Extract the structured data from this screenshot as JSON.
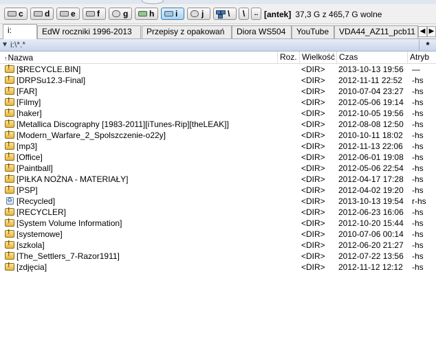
{
  "drive_bar": {
    "drives": [
      {
        "letter": "c",
        "icon": "hard-drive-icon"
      },
      {
        "letter": "d",
        "icon": "hard-drive-icon"
      },
      {
        "letter": "e",
        "icon": "hard-drive-icon"
      },
      {
        "letter": "f",
        "icon": "hard-drive-icon"
      },
      {
        "letter": "g",
        "icon": "usb-drive-icon"
      },
      {
        "letter": "h",
        "icon": "optical-drive-icon"
      },
      {
        "letter": "i",
        "icon": "hard-drive-icon",
        "active": true
      },
      {
        "letter": "j",
        "icon": "usb-drive-icon"
      }
    ],
    "net_icon": "network-icon",
    "root_label": "\\",
    "up_label": "..",
    "volume_label": "[antek]",
    "free_space": "37,3 G z 465,7 G wolne"
  },
  "tabs": [
    {
      "label": "i:",
      "active": true
    },
    {
      "label": "EdW roczniki 1996-2013"
    },
    {
      "label": "Przepisy z opakowań"
    },
    {
      "label": "Diora WS504"
    },
    {
      "label": "YouTube"
    },
    {
      "label": "VDA44_AZ11_pcb11"
    }
  ],
  "tab_nav": {
    "prev": "◀",
    "next": "▶"
  },
  "path_bar": {
    "filter_icon": "▾",
    "path": "i:\\*.*",
    "history_label": "*"
  },
  "columns": {
    "sort_arrow": "↑",
    "name": "Nazwa",
    "ext": "Roz.",
    "size": "Wielkość",
    "date": "Czas",
    "attr": "Atryb"
  },
  "files": [
    {
      "name": "[$RECYCLE.BIN]",
      "size": "<DIR>",
      "date": "2013-10-13 19:56",
      "attr": "—",
      "icon": "folder-icon"
    },
    {
      "name": "[DRPSu12.3-Final]",
      "size": "<DIR>",
      "date": "2012-11-11 22:52",
      "attr": "-hs",
      "icon": "folder-icon"
    },
    {
      "name": "[FAR]",
      "size": "<DIR>",
      "date": "2010-07-04 23:27",
      "attr": "-hs",
      "icon": "folder-icon"
    },
    {
      "name": "[Filmy]",
      "size": "<DIR>",
      "date": "2012-05-06 19:14",
      "attr": "-hs",
      "icon": "folder-icon"
    },
    {
      "name": "[haker]",
      "size": "<DIR>",
      "date": "2012-10-05 19:56",
      "attr": "-hs",
      "icon": "folder-icon"
    },
    {
      "name": "[Metallica Discography [1983-2011][iTunes-Rip][theLEAK]]",
      "size": "<DIR>",
      "date": "2012-08-08 12:50",
      "attr": "-hs",
      "icon": "folder-icon"
    },
    {
      "name": "[Modern_Warfare_2_Spolszczenie-o22y]",
      "size": "<DIR>",
      "date": "2010-10-11 18:02",
      "attr": "-hs",
      "icon": "folder-icon"
    },
    {
      "name": "[mp3]",
      "size": "<DIR>",
      "date": "2012-11-13 22:06",
      "attr": "-hs",
      "icon": "folder-icon"
    },
    {
      "name": "[Office]",
      "size": "<DIR>",
      "date": "2012-06-01 19:08",
      "attr": "-hs",
      "icon": "folder-icon"
    },
    {
      "name": "[Paintball]",
      "size": "<DIR>",
      "date": "2012-05-06 22:54",
      "attr": "-hs",
      "icon": "folder-icon"
    },
    {
      "name": "[PIŁKA NOŻNA  - MATERIAŁY]",
      "size": "<DIR>",
      "date": "2012-04-17 17:28",
      "attr": "-hs",
      "icon": "folder-icon"
    },
    {
      "name": "[PSP]",
      "size": "<DIR>",
      "date": "2012-04-02 19:20",
      "attr": "-hs",
      "icon": "folder-icon"
    },
    {
      "name": "[Recycled]",
      "size": "<DIR>",
      "date": "2013-10-13 19:54",
      "attr": "r-hs",
      "icon": "recycle-bin-icon"
    },
    {
      "name": "[RECYCLER]",
      "size": "<DIR>",
      "date": "2012-06-23 16:06",
      "attr": "-hs",
      "icon": "folder-icon"
    },
    {
      "name": "[System Volume Information]",
      "size": "<DIR>",
      "date": "2012-10-20 15:44",
      "attr": "-hs",
      "icon": "folder-icon"
    },
    {
      "name": "[systemowe]",
      "size": "<DIR>",
      "date": "2010-07-06 00:14",
      "attr": "-hs",
      "icon": "folder-icon"
    },
    {
      "name": "[szkola]",
      "size": "<DIR>",
      "date": "2012-06-20 21:27",
      "attr": "-hs",
      "icon": "folder-icon"
    },
    {
      "name": "[The_Settlers_7-Razor1911]",
      "size": "<DIR>",
      "date": "2012-07-22 13:56",
      "attr": "-hs",
      "icon": "folder-icon"
    },
    {
      "name": "[zdjęcia]",
      "size": "<DIR>",
      "date": "2012-11-12 12:12",
      "attr": "-hs",
      "icon": "folder-icon"
    }
  ]
}
